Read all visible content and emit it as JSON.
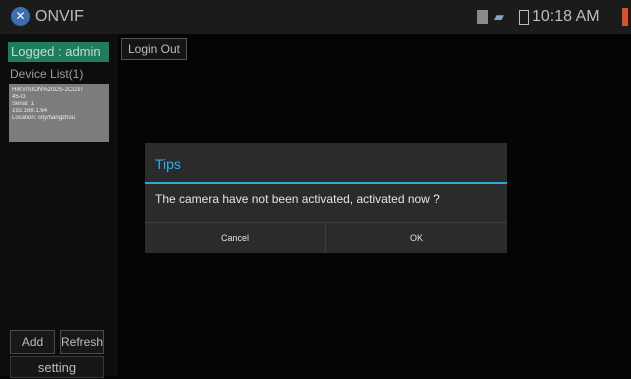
{
  "app": {
    "title": "ONVIF",
    "logo_icon": "onvif-x-logo-icon"
  },
  "status_bar": {
    "time": "10:18 AM",
    "icons": [
      "sd-card-icon",
      "network-icon",
      "battery-icon",
      "alert-icon"
    ]
  },
  "sidebar": {
    "logged_label": "Logged : admin",
    "device_list_header": "Device List(1)",
    "device": {
      "name_line1": "HIKVISION%20DS-2CD3T",
      "name_line2": "45-I3",
      "serial": "Serial: 1",
      "ip": "192.168.1.64",
      "location": "Location: city/hangzhou"
    },
    "add_label": "Add",
    "refresh_label": "Refresh",
    "setting_label": "setting"
  },
  "main": {
    "login_out_label": "Login Out"
  },
  "dialog": {
    "title": "Tips",
    "message": "The camera have not been activated, activated now ?",
    "cancel_label": "Cancel",
    "ok_label": "OK"
  },
  "colors": {
    "accent": "#2fb0e8",
    "logged_badge": "#1f7d5f",
    "device_card": "#7c7c7c"
  }
}
